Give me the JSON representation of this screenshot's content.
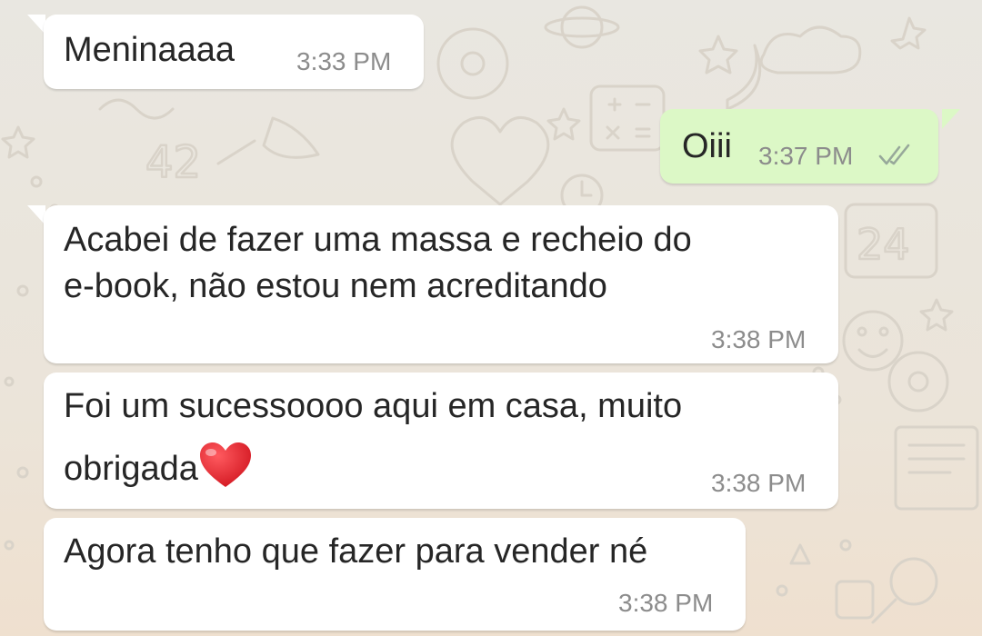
{
  "chat": {
    "messages": [
      {
        "direction": "incoming",
        "text": "Meninaaaa",
        "time": "3:33 PM"
      },
      {
        "direction": "outgoing",
        "text": "Oiii",
        "time": "3:37 PM",
        "status": "read",
        "status_icon": "double-check-icon"
      },
      {
        "direction": "incoming",
        "text_lines": [
          "Acabei de fazer uma massa e recheio do",
          "e-book, não estou nem acreditando"
        ],
        "time": "3:38 PM"
      },
      {
        "direction": "incoming",
        "text_lines": [
          "Foi um sucessoooo aqui em casa, muito",
          "obrigada"
        ],
        "emoji": "red-heart",
        "time": "3:38 PM"
      },
      {
        "direction": "incoming",
        "text": "Agora tenho que fazer para vender né",
        "time": "3:38 PM"
      }
    ]
  },
  "colors": {
    "background": "#ece5dd",
    "incoming_bubble": "#ffffff",
    "outgoing_bubble": "#dcf8c6",
    "text": "#262626",
    "timestamp": "#8c8c8c",
    "heart": "#e0242f"
  }
}
